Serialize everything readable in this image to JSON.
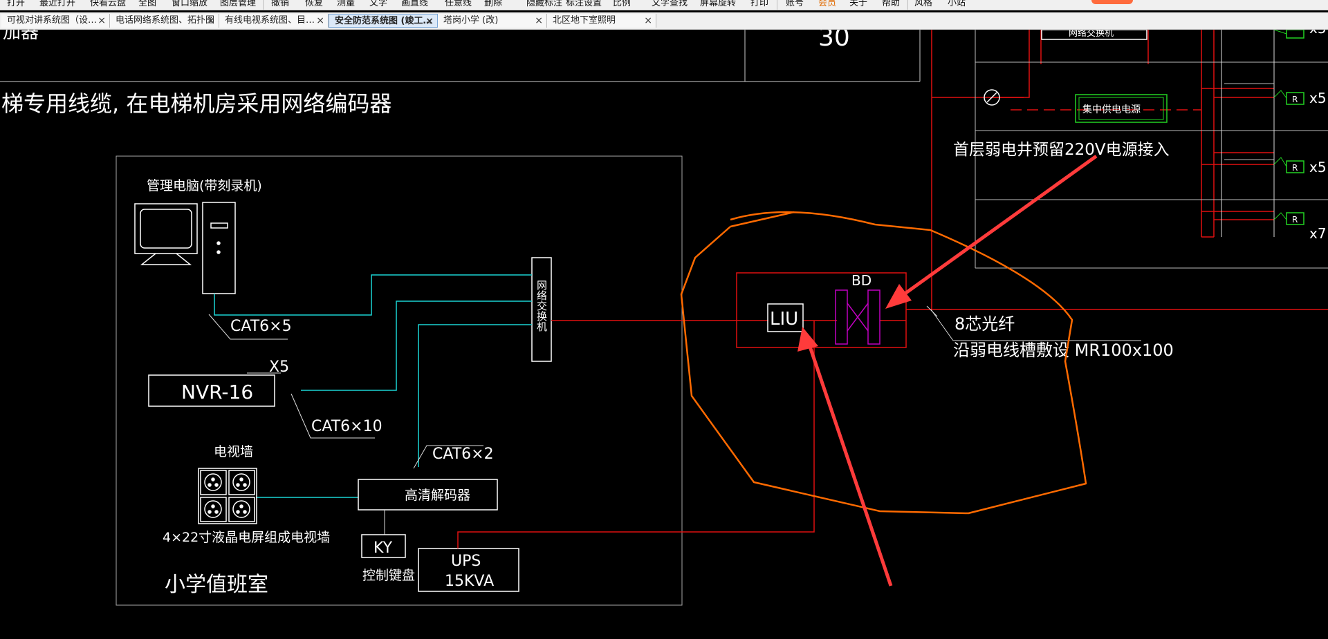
{
  "menubar": {
    "items": [
      "打开",
      "最近打开",
      "快看云盘",
      "全图",
      "窗口缩放",
      "图层管理",
      "撤销",
      "恢复",
      "测量",
      "文字",
      "画直线",
      "任意线",
      "删除",
      "隐藏标注",
      "标注设置",
      "比例",
      "文字查找",
      "屏幕旋转",
      "打印",
      "账号",
      "会员",
      "关于",
      "帮助",
      "风格",
      "小站"
    ],
    "highlight_color": "#e06a00"
  },
  "tabs": [
    {
      "label": "可视对讲系统图（设…",
      "close": "×",
      "active": false
    },
    {
      "label": "电话网络系统图、拓扑图",
      "close": "×",
      "active": false
    },
    {
      "label": "有线电视系统图、目…",
      "close": "×",
      "active": false
    },
    {
      "label": "安全防范系统图 (竣工…",
      "close": "×",
      "active": true
    },
    {
      "label": "塔岗小学 (改)",
      "close": "×",
      "active": false
    },
    {
      "label": "北区地下室照明",
      "close": "×",
      "active": false
    }
  ],
  "drawing": {
    "top_partial_text": "加器",
    "top_number": "30",
    "cable_note": "梯专用线缆, 在电梯机房采用网络编码器",
    "pc_label": "管理电脑(带刻录机)",
    "switch_label": "网络交换机",
    "cat_a": "CAT6×5",
    "nvr_multiplier": "X5",
    "nvr_label": "NVR-16",
    "cat_b": "CAT6×10",
    "cat_c": "CAT6×2",
    "tv_wall_label": "电视墙",
    "tv_wall_note": "4×22寸液晶电屏组成电视墙",
    "decoder_label": "高清解码器",
    "ky_label": "KY",
    "keyboard_label": "控制键盘",
    "ups_line1": "UPS",
    "ups_line2": "15KVA",
    "room_label": "小学值班室",
    "bd_label": "BD",
    "liu_label": "LIU",
    "fiber_label": "8芯光纤",
    "fiber_route": "沿弱电线槽敷设 MR100x100",
    "power_label": "集中供电电源",
    "power_note": "首层弱电井预留220V电源接入",
    "top_right_box": "网络交换机",
    "r_label": "R",
    "x5": "x5",
    "x7": "x7"
  },
  "colors": {
    "wire_cyan": "#1bd4d4",
    "wire_red": "#e01010",
    "annotation_orange": "#ff6a00",
    "arrow_red": "#ff3b3b",
    "magenta": "#c000c0",
    "green": "#22d322"
  }
}
